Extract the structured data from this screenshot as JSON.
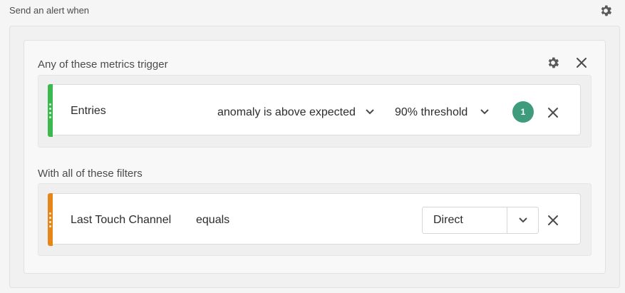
{
  "header": {
    "title": "Send an alert when",
    "settings_icon": "gear-icon"
  },
  "metrics_section": {
    "label": "Any of these metrics trigger",
    "settings_icon": "gear-icon",
    "close_icon": "close-icon",
    "row": {
      "accent_color": "#3cb94e",
      "metric": "Entries",
      "condition": "anomaly is above expected",
      "threshold": "90% threshold",
      "badge_count": "1",
      "badge_color": "#3e9c7c"
    }
  },
  "filters_section": {
    "label": "With all of these filters",
    "row": {
      "accent_color": "#e68619",
      "dimension": "Last Touch Channel",
      "operator": "equals",
      "value": "Direct"
    }
  }
}
